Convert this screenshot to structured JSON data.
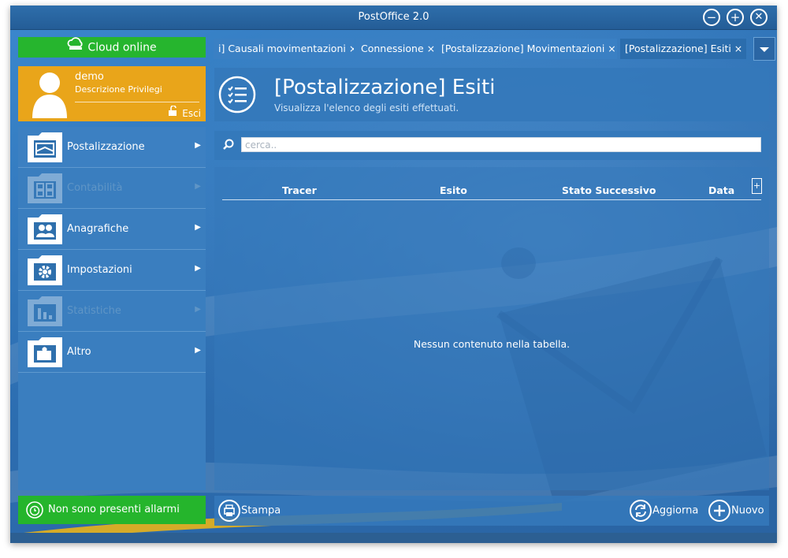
{
  "window": {
    "title": "PostOffice 2.0",
    "controls": [
      "minimize-icon",
      "maximize-icon",
      "close-icon"
    ]
  },
  "sidebar": {
    "cloud_status": "Cloud online",
    "user": {
      "name": "demo",
      "description": "Descrizione Privilegi",
      "logout_label": "Esci"
    },
    "menu": [
      {
        "label": "Postalizzazione",
        "icon": "envelope-icon",
        "enabled": true
      },
      {
        "label": "Contabilità",
        "icon": "calculator-icon",
        "enabled": false
      },
      {
        "label": "Anagrafiche",
        "icon": "people-icon",
        "enabled": true
      },
      {
        "label": "Impostazioni",
        "icon": "gear-icon",
        "enabled": true
      },
      {
        "label": "Statistiche",
        "icon": "bar-chart-icon",
        "enabled": false
      },
      {
        "label": "Altro",
        "icon": "puzzle-icon",
        "enabled": true
      }
    ],
    "alarm_text": "Non sono presenti allarmi"
  },
  "tabs": [
    {
      "label": "i] Causali movimentazioni ×",
      "active": false
    },
    {
      "label": "Connessione ×",
      "active": false
    },
    {
      "label": "[Postalizzazione] Movimentazioni ×",
      "active": false
    },
    {
      "label": "[Postalizzazione] Esiti ×",
      "active": true
    }
  ],
  "header": {
    "title": "[Postalizzazione] Esiti",
    "subtitle": "Visualizza l'elenco degli esiti effettuati."
  },
  "search": {
    "placeholder": "cerca..",
    "value": ""
  },
  "table": {
    "columns": [
      "Tracer",
      "Esito",
      "Stato Successivo",
      "Data"
    ],
    "empty_message": "Nessun contenuto nella tabella.",
    "add_column_symbol": "+"
  },
  "footer": {
    "print_label": "Stampa",
    "refresh_label": "Aggiorna",
    "new_label": "Nuovo"
  },
  "colors": {
    "accent_blue": "#2f70ad",
    "cloud_green": "#26b52e",
    "user_orange": "#e9a51a"
  }
}
